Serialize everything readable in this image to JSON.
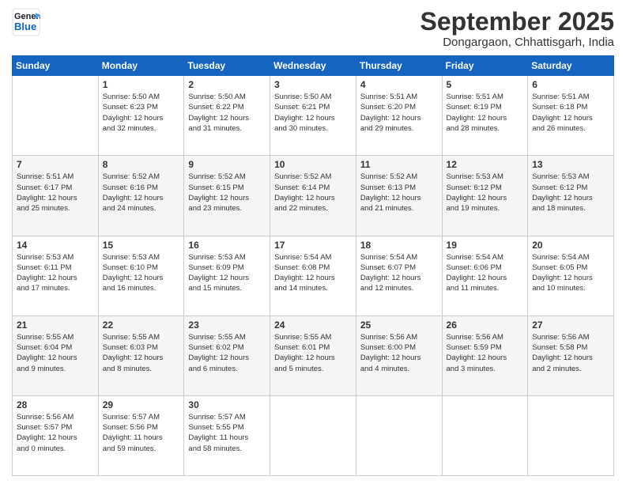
{
  "header": {
    "logo_line1": "General",
    "logo_line2": "Blue",
    "month": "September 2025",
    "location": "Dongargaon, Chhattisgarh, India"
  },
  "weekdays": [
    "Sunday",
    "Monday",
    "Tuesday",
    "Wednesday",
    "Thursday",
    "Friday",
    "Saturday"
  ],
  "weeks": [
    [
      {
        "day": "",
        "info": ""
      },
      {
        "day": "1",
        "info": "Sunrise: 5:50 AM\nSunset: 6:23 PM\nDaylight: 12 hours\nand 32 minutes."
      },
      {
        "day": "2",
        "info": "Sunrise: 5:50 AM\nSunset: 6:22 PM\nDaylight: 12 hours\nand 31 minutes."
      },
      {
        "day": "3",
        "info": "Sunrise: 5:50 AM\nSunset: 6:21 PM\nDaylight: 12 hours\nand 30 minutes."
      },
      {
        "day": "4",
        "info": "Sunrise: 5:51 AM\nSunset: 6:20 PM\nDaylight: 12 hours\nand 29 minutes."
      },
      {
        "day": "5",
        "info": "Sunrise: 5:51 AM\nSunset: 6:19 PM\nDaylight: 12 hours\nand 28 minutes."
      },
      {
        "day": "6",
        "info": "Sunrise: 5:51 AM\nSunset: 6:18 PM\nDaylight: 12 hours\nand 26 minutes."
      }
    ],
    [
      {
        "day": "7",
        "info": "Sunrise: 5:51 AM\nSunset: 6:17 PM\nDaylight: 12 hours\nand 25 minutes."
      },
      {
        "day": "8",
        "info": "Sunrise: 5:52 AM\nSunset: 6:16 PM\nDaylight: 12 hours\nand 24 minutes."
      },
      {
        "day": "9",
        "info": "Sunrise: 5:52 AM\nSunset: 6:15 PM\nDaylight: 12 hours\nand 23 minutes."
      },
      {
        "day": "10",
        "info": "Sunrise: 5:52 AM\nSunset: 6:14 PM\nDaylight: 12 hours\nand 22 minutes."
      },
      {
        "day": "11",
        "info": "Sunrise: 5:52 AM\nSunset: 6:13 PM\nDaylight: 12 hours\nand 21 minutes."
      },
      {
        "day": "12",
        "info": "Sunrise: 5:53 AM\nSunset: 6:12 PM\nDaylight: 12 hours\nand 19 minutes."
      },
      {
        "day": "13",
        "info": "Sunrise: 5:53 AM\nSunset: 6:12 PM\nDaylight: 12 hours\nand 18 minutes."
      }
    ],
    [
      {
        "day": "14",
        "info": "Sunrise: 5:53 AM\nSunset: 6:11 PM\nDaylight: 12 hours\nand 17 minutes."
      },
      {
        "day": "15",
        "info": "Sunrise: 5:53 AM\nSunset: 6:10 PM\nDaylight: 12 hours\nand 16 minutes."
      },
      {
        "day": "16",
        "info": "Sunrise: 5:53 AM\nSunset: 6:09 PM\nDaylight: 12 hours\nand 15 minutes."
      },
      {
        "day": "17",
        "info": "Sunrise: 5:54 AM\nSunset: 6:08 PM\nDaylight: 12 hours\nand 14 minutes."
      },
      {
        "day": "18",
        "info": "Sunrise: 5:54 AM\nSunset: 6:07 PM\nDaylight: 12 hours\nand 12 minutes."
      },
      {
        "day": "19",
        "info": "Sunrise: 5:54 AM\nSunset: 6:06 PM\nDaylight: 12 hours\nand 11 minutes."
      },
      {
        "day": "20",
        "info": "Sunrise: 5:54 AM\nSunset: 6:05 PM\nDaylight: 12 hours\nand 10 minutes."
      }
    ],
    [
      {
        "day": "21",
        "info": "Sunrise: 5:55 AM\nSunset: 6:04 PM\nDaylight: 12 hours\nand 9 minutes."
      },
      {
        "day": "22",
        "info": "Sunrise: 5:55 AM\nSunset: 6:03 PM\nDaylight: 12 hours\nand 8 minutes."
      },
      {
        "day": "23",
        "info": "Sunrise: 5:55 AM\nSunset: 6:02 PM\nDaylight: 12 hours\nand 6 minutes."
      },
      {
        "day": "24",
        "info": "Sunrise: 5:55 AM\nSunset: 6:01 PM\nDaylight: 12 hours\nand 5 minutes."
      },
      {
        "day": "25",
        "info": "Sunrise: 5:56 AM\nSunset: 6:00 PM\nDaylight: 12 hours\nand 4 minutes."
      },
      {
        "day": "26",
        "info": "Sunrise: 5:56 AM\nSunset: 5:59 PM\nDaylight: 12 hours\nand 3 minutes."
      },
      {
        "day": "27",
        "info": "Sunrise: 5:56 AM\nSunset: 5:58 PM\nDaylight: 12 hours\nand 2 minutes."
      }
    ],
    [
      {
        "day": "28",
        "info": "Sunrise: 5:56 AM\nSunset: 5:57 PM\nDaylight: 12 hours\nand 0 minutes."
      },
      {
        "day": "29",
        "info": "Sunrise: 5:57 AM\nSunset: 5:56 PM\nDaylight: 11 hours\nand 59 minutes."
      },
      {
        "day": "30",
        "info": "Sunrise: 5:57 AM\nSunset: 5:55 PM\nDaylight: 11 hours\nand 58 minutes."
      },
      {
        "day": "",
        "info": ""
      },
      {
        "day": "",
        "info": ""
      },
      {
        "day": "",
        "info": ""
      },
      {
        "day": "",
        "info": ""
      }
    ]
  ]
}
